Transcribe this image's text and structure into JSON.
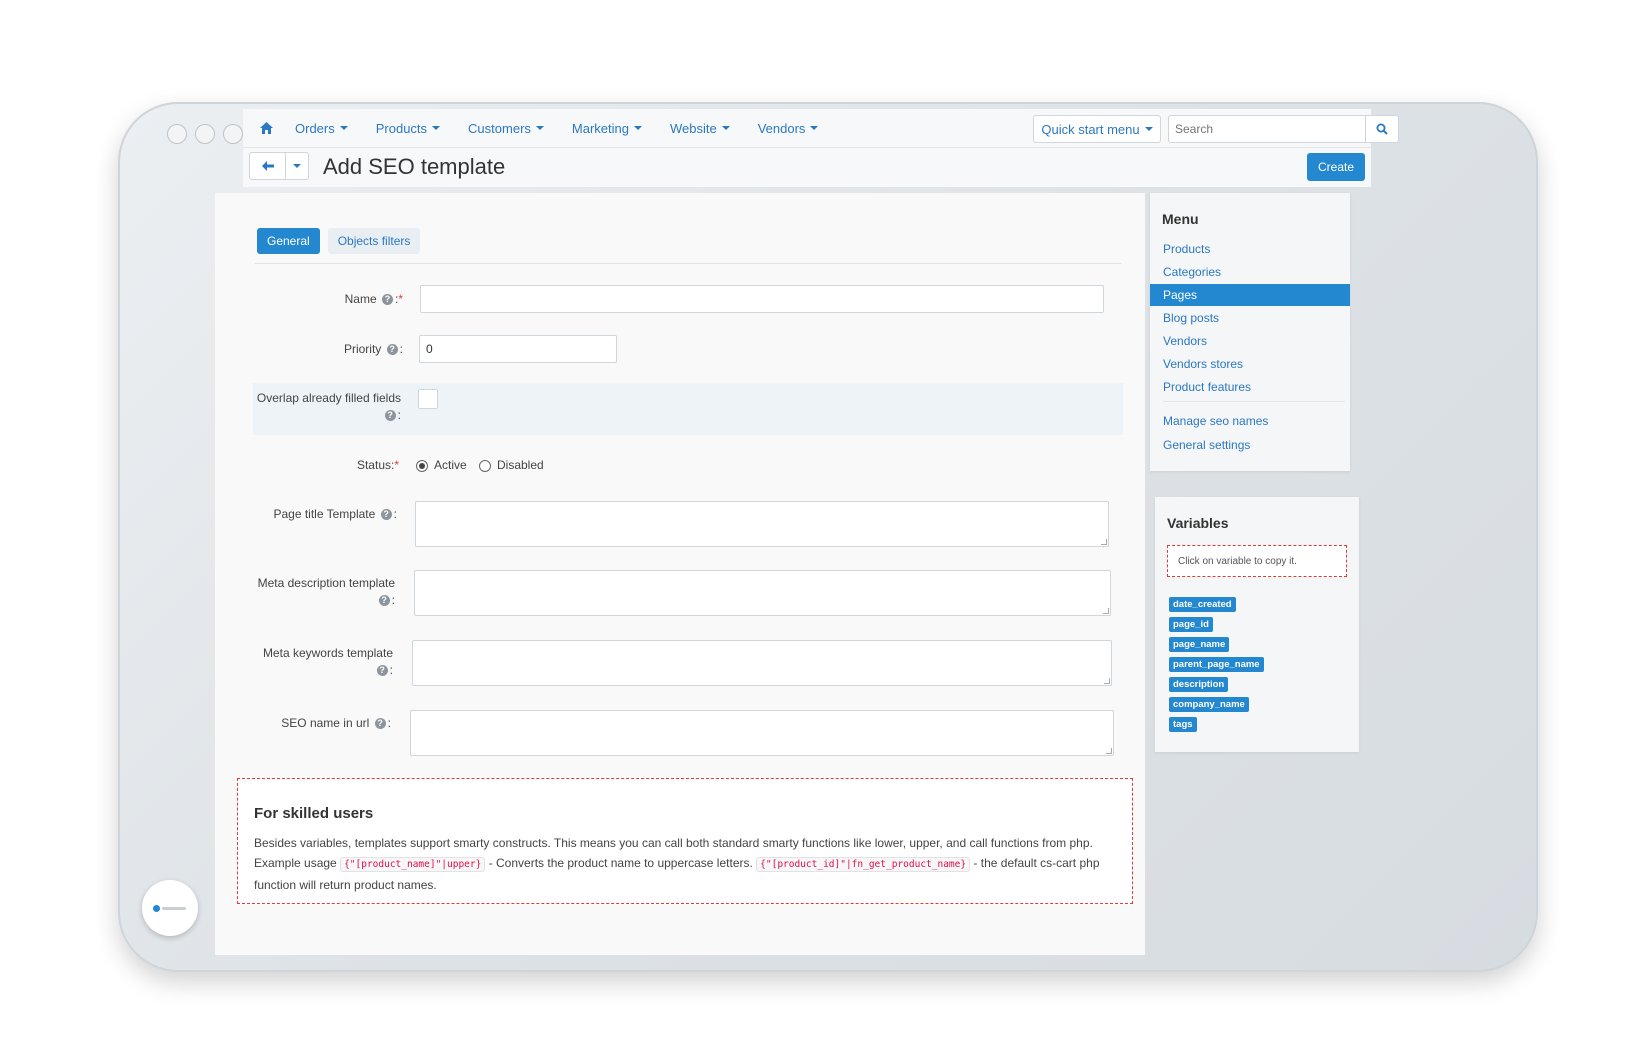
{
  "nav": {
    "items": [
      "Orders",
      "Products",
      "Customers",
      "Marketing",
      "Website",
      "Vendors"
    ],
    "quick_start": "Quick start menu",
    "search_placeholder": "Search"
  },
  "header": {
    "title": "Add SEO template",
    "create_label": "Create"
  },
  "tabs": [
    "General",
    "Objects filters"
  ],
  "form": {
    "name_label": "Name",
    "priority_label": "Priority",
    "priority_value": "0",
    "overlap_label": "Overlap already filled fields",
    "status_label": "Status:",
    "status_active": "Active",
    "status_disabled": "Disabled",
    "page_title_label": "Page title Template",
    "meta_desc_label": "Meta description template",
    "meta_keywords_label": "Meta keywords template",
    "seo_name_label": "SEO name in url"
  },
  "skilled": {
    "title": "For skilled users",
    "text1": "Besides variables, templates support smarty constructs. This means you can call both standard smarty functions like lower, upper, and call functions from php.",
    "example": "Example usage",
    "code1": "{\"[product_name]\"|upper}",
    "mid": "- Converts the product name to uppercase letters.",
    "code2": "{\"[product_id]\"|fn_get_product_name}",
    "tail": "- the default cs-cart php function will return product names."
  },
  "menu": {
    "title": "Menu",
    "items": [
      "Products",
      "Categories",
      "Pages",
      "Blog posts",
      "Vendors",
      "Vendors stores",
      "Product features"
    ],
    "extra": [
      "Manage seo names",
      "General settings"
    ]
  },
  "variables": {
    "title": "Variables",
    "hint": "Click on variable to copy it.",
    "tags": [
      "date_created",
      "page_id",
      "page_name",
      "parent_page_name",
      "description",
      "company_name",
      "tags"
    ]
  },
  "colors": {
    "accent": "#2388d0",
    "link": "#2b78c2",
    "required": "#e03a3a"
  }
}
